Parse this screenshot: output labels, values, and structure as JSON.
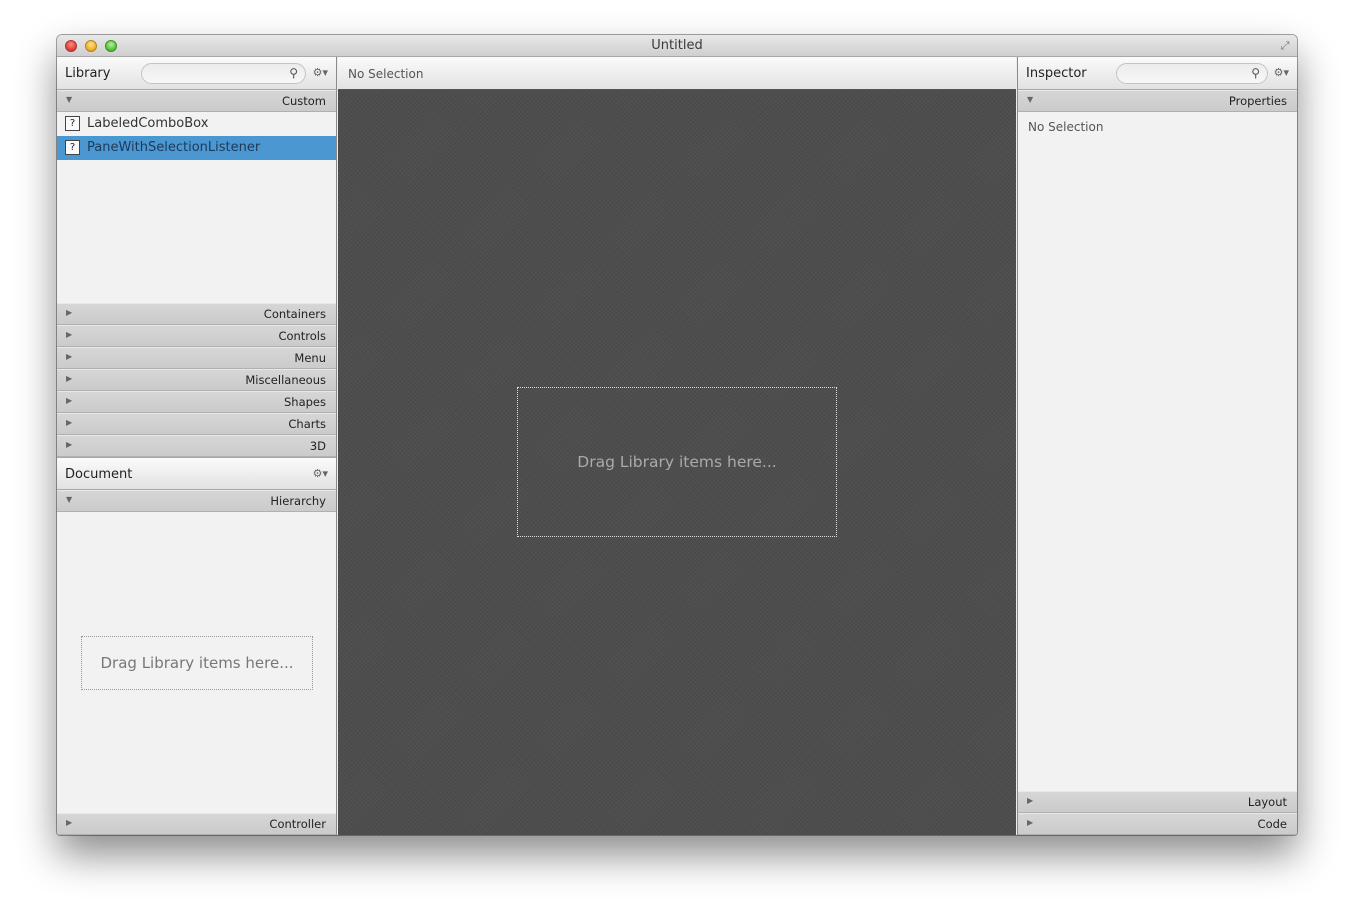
{
  "window": {
    "title": "Untitled"
  },
  "library": {
    "title": "Library",
    "search_placeholder": "",
    "custom_section": "Custom",
    "custom_items": [
      {
        "label": "LabeledComboBox",
        "icon": "?",
        "selected": false
      },
      {
        "label": "PaneWithSelectionListener",
        "icon": "?",
        "selected": true
      }
    ],
    "sections": [
      "Containers",
      "Controls",
      "Menu",
      "Miscellaneous",
      "Shapes",
      "Charts",
      "3D"
    ]
  },
  "document": {
    "title": "Document",
    "hierarchy_section": "Hierarchy",
    "dropzone_text": "Drag Library items here...",
    "controller_section": "Controller"
  },
  "content": {
    "selection_text": "No Selection",
    "dropzone_text": "Drag Library items here..."
  },
  "inspector": {
    "title": "Inspector",
    "search_placeholder": "",
    "properties_section": "Properties",
    "no_selection_text": "No Selection",
    "layout_section": "Layout",
    "code_section": "Code"
  },
  "colors": {
    "selection": "#4a97d2",
    "canvas": "#4d4d4d"
  }
}
